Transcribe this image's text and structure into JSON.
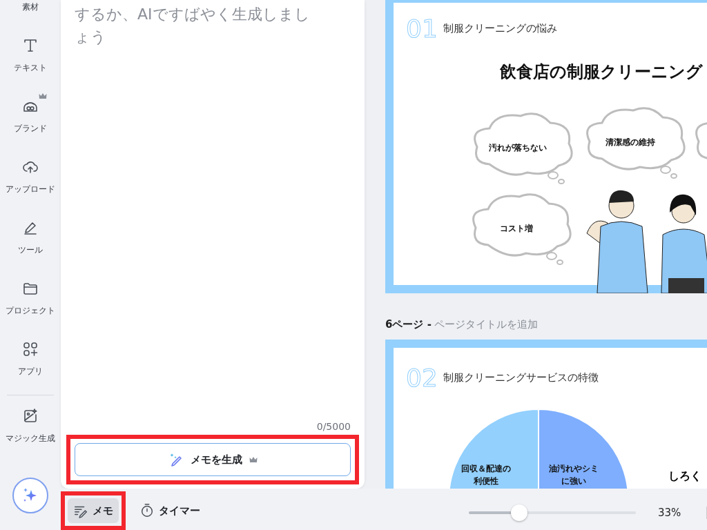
{
  "sidebar": {
    "items": [
      {
        "label": "素材",
        "kind": "elements",
        "premium": false
      },
      {
        "label": "テキスト",
        "kind": "text",
        "premium": false
      },
      {
        "label": "ブランド",
        "kind": "brand",
        "premium": true
      },
      {
        "label": "アップロード",
        "kind": "upload",
        "premium": false
      },
      {
        "label": "ツール",
        "kind": "tools",
        "premium": false
      },
      {
        "label": "プロジェクト",
        "kind": "projects",
        "premium": false
      },
      {
        "label": "アプリ",
        "kind": "apps",
        "premium": false
      },
      {
        "label": "マジック生成",
        "kind": "magic_media",
        "premium": false
      }
    ]
  },
  "notes_panel": {
    "placeholder": "するか、AIですばやく生成しましょう",
    "counter": "0/5000",
    "generate_button": {
      "label": "メモを生成",
      "premium": true,
      "highlighted": true
    }
  },
  "slides": [
    {
      "kind": "thoughts",
      "number": "01",
      "title": "制服クリーニングの悩み",
      "heading": "飲食店の制服クリーニング",
      "thoughts": [
        "汚れが落ちない",
        "清潔感の維持",
        "コスト増"
      ]
    },
    {
      "kind": "pie",
      "page": "6ページ -",
      "page_title_placeholder": "ページタイトルを追加",
      "number": "02",
      "title": "制服クリーニングサービスの特徴",
      "segments": [
        {
          "label": "回収＆配達の利便性",
          "color": "#93d0fd"
        },
        {
          "label": "油汚れやシミに強い",
          "color": "#7eaefd"
        }
      ],
      "side_text": "しろく"
    }
  ],
  "bottom_bar": {
    "notes_button": {
      "label": "メモ",
      "selected": true,
      "highlighted": true
    },
    "timer_button": {
      "label": "タイマー",
      "selected": false,
      "highlighted": false
    },
    "zoom": {
      "level": 0.32,
      "reading": "33%"
    }
  }
}
